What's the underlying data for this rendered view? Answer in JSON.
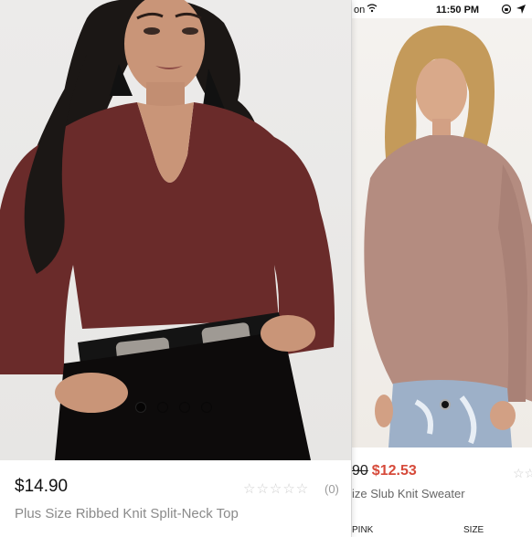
{
  "status_bar": {
    "carrier": "on",
    "time": "11:50 PM"
  },
  "front_card": {
    "price": "$14.90",
    "title": "Plus Size Ribbed Knit Split-Neck Top",
    "rating_stars": "☆☆☆☆☆",
    "reviews": "(0)",
    "carousel": {
      "total": 4,
      "active_index": 0
    }
  },
  "back_card": {
    "old_price": "90",
    "sale_price": "$12.53",
    "title": "ize Slub Knit Sweater",
    "rating_stars": "☆☆",
    "option1_label": "PINK",
    "option2_label": "SIZE"
  },
  "colors": {
    "sale": "#d64a3a",
    "top_burgundy": "#6a2b2a",
    "sweater_tan": "#b48c80",
    "denim": "#9db0c8"
  },
  "icons": [
    "wifi-icon",
    "lock-rotation-icon",
    "location-arrow-icon",
    "star-icon",
    "carousel-dot-icon"
  ]
}
